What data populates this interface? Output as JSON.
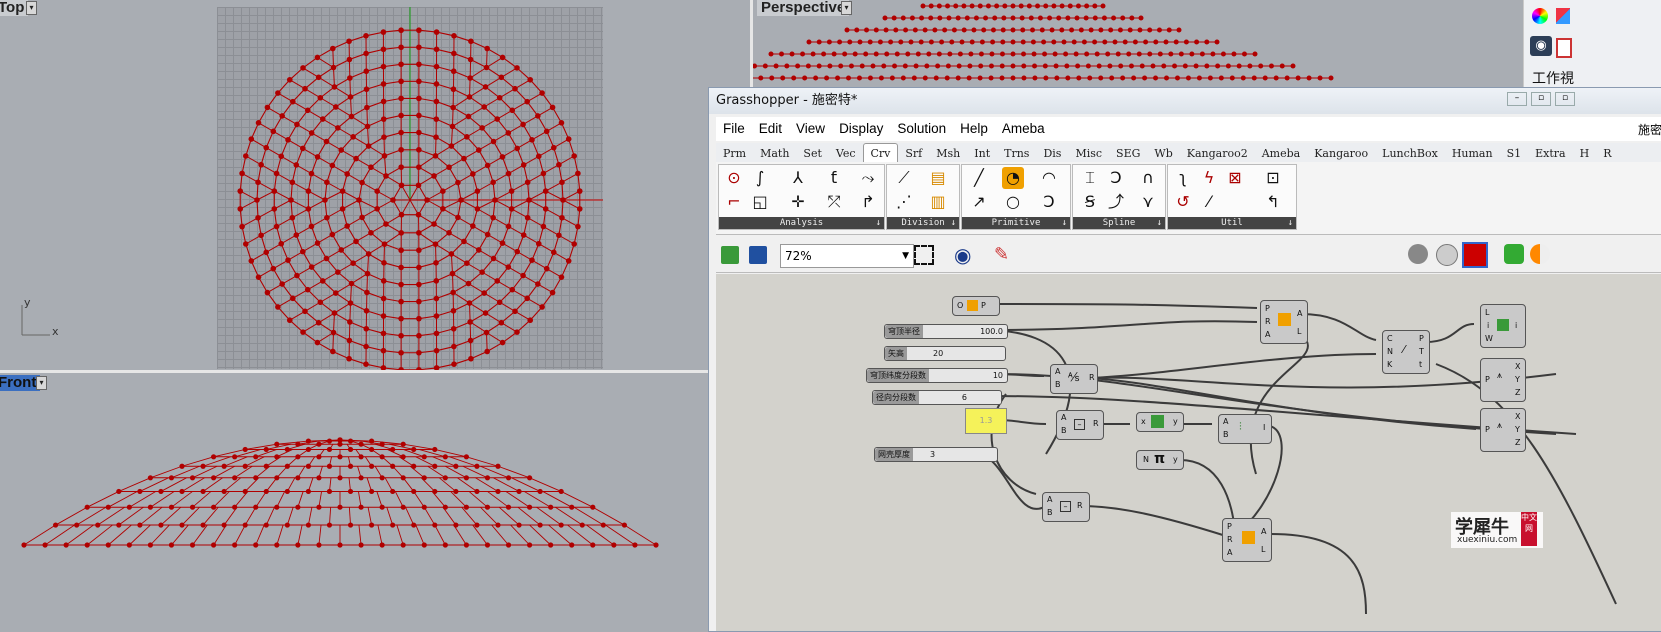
{
  "viewports": {
    "top": {
      "label": "Top",
      "axis_y": "y",
      "axis_x": "x"
    },
    "perspective": {
      "label": "Perspective"
    },
    "front": {
      "label": "Front"
    }
  },
  "right_panel": {
    "label": "工作視"
  },
  "grasshopper": {
    "title": "Grasshopper - 施密特*",
    "menu": [
      "File",
      "Edit",
      "View",
      "Display",
      "Solution",
      "Help",
      "Ameba"
    ],
    "menu_right": "施密",
    "tabs": [
      "Prm",
      "Math",
      "Set",
      "Vec",
      "Crv",
      "Srf",
      "Msh",
      "Int",
      "Trns",
      "Dis",
      "Misc",
      "SEG",
      "Wb",
      "Kangaroo2",
      "Ameba",
      "Kangaroo",
      "LunchBox",
      "Human",
      "S1",
      "Extra",
      "H",
      "R"
    ],
    "active_tab": "Crv",
    "panels": [
      "Analysis",
      "Division",
      "Primitive",
      "Spline",
      "Util"
    ],
    "zoom": "72%",
    "sliders": [
      {
        "name": "穹顶半径",
        "value": "100.0"
      },
      {
        "name": "矢高",
        "value": "20"
      },
      {
        "name": "穹顶纬度分段数",
        "value": "10"
      },
      {
        "name": "径向分段数",
        "value": "6"
      },
      {
        "name": "网壳厚度",
        "value": "3"
      }
    ],
    "panel_value": "1.3",
    "watermark": {
      "main": "学犀牛",
      "sub": "xuexiniu.com",
      "badge": "中文网"
    }
  },
  "colors": {
    "dome": "#b00000",
    "viewport_bg": "#a9adb3",
    "gh_canvas": "#d3d2cc",
    "panel_yellow": "#f5f25a"
  }
}
